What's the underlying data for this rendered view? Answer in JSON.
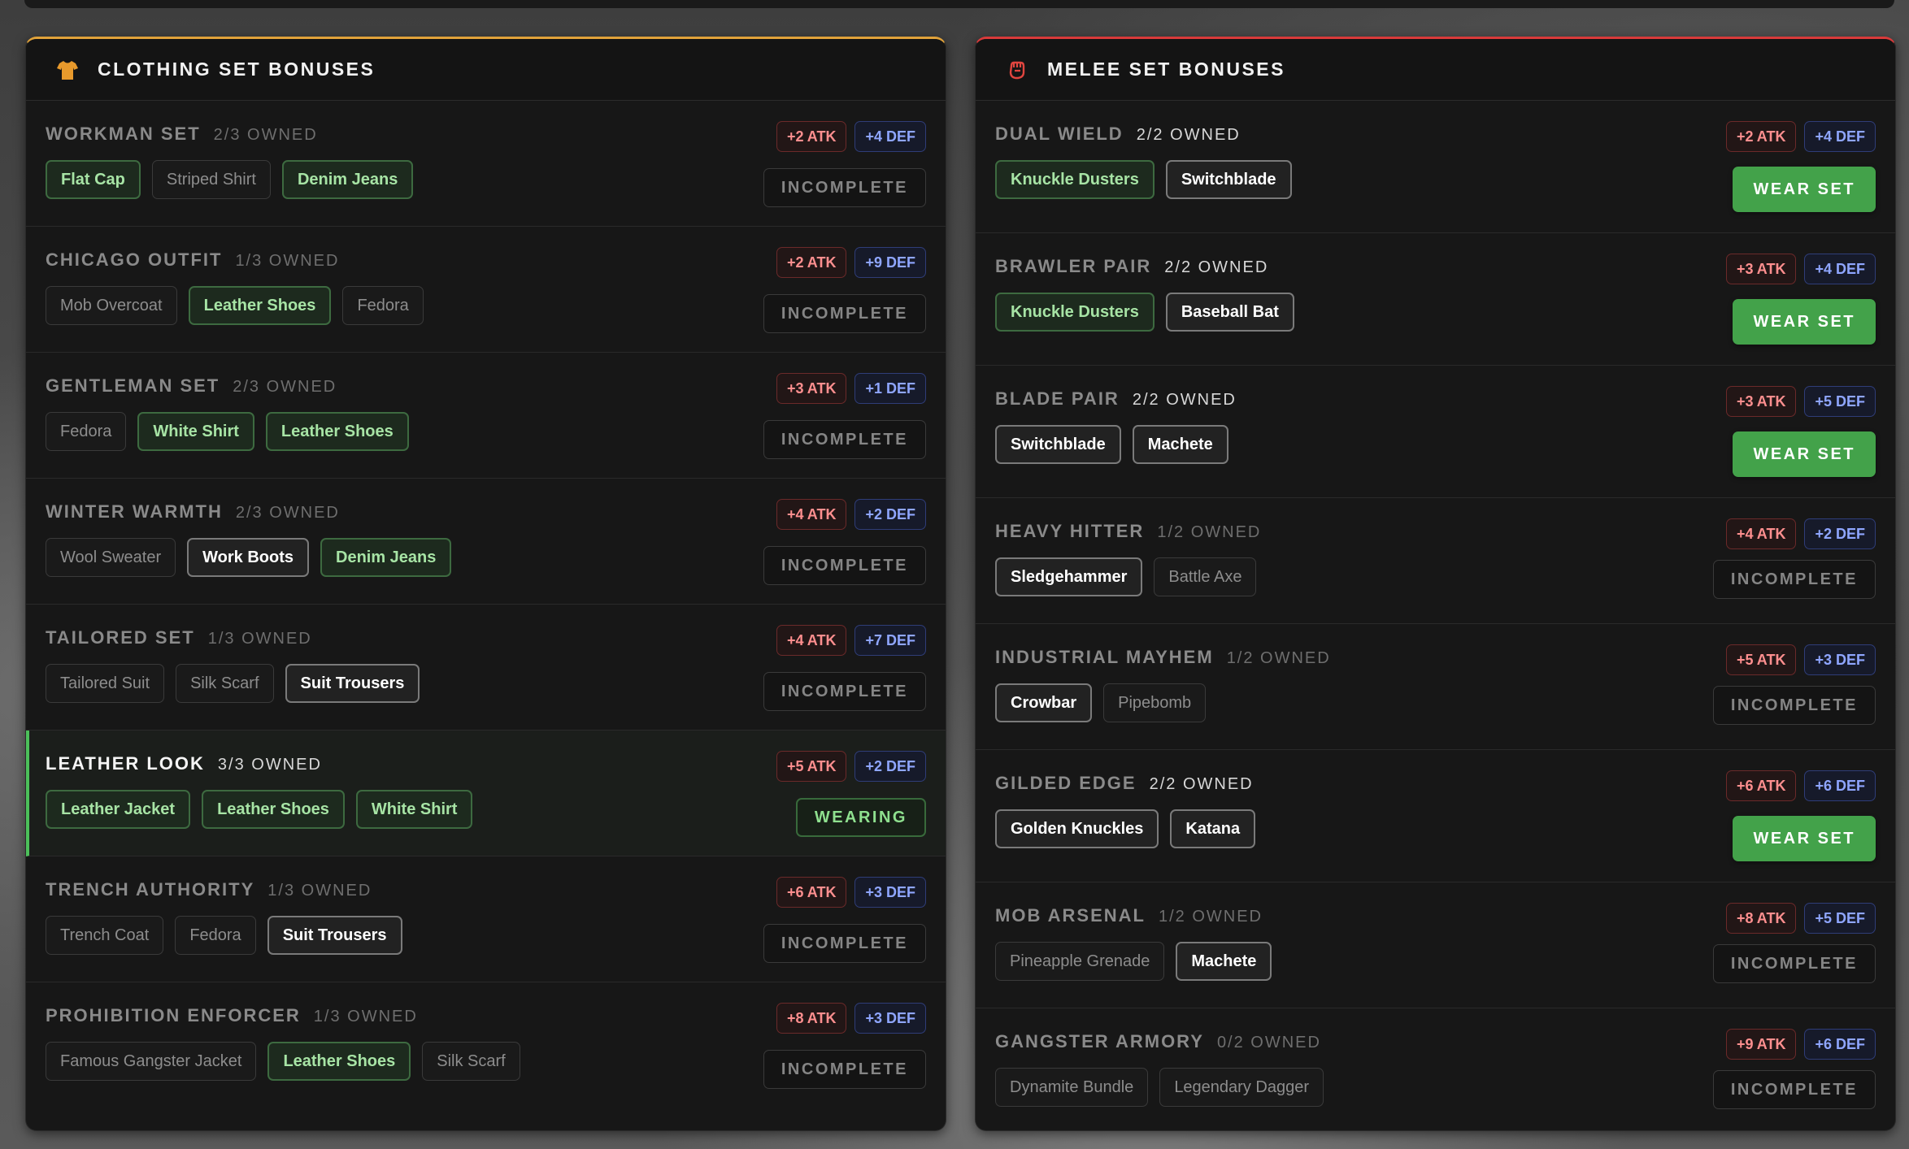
{
  "clothing": {
    "title": "CLOTHING SET BONUSES",
    "icon": "shirt-icon",
    "accent": "#e0a23a",
    "sets": [
      {
        "name": "WORKMAN SET",
        "owned": "2/3 OWNED",
        "atk": "+2 ATK",
        "def": "+4 DEF",
        "status": "INCOMPLETE",
        "items": [
          {
            "label": "Flat Cap",
            "state": "equipped"
          },
          {
            "label": "Striped Shirt",
            "state": "missing"
          },
          {
            "label": "Denim Jeans",
            "state": "equipped"
          }
        ]
      },
      {
        "name": "CHICAGO OUTFIT",
        "owned": "1/3 OWNED",
        "atk": "+2 ATK",
        "def": "+9 DEF",
        "status": "INCOMPLETE",
        "items": [
          {
            "label": "Mob Overcoat",
            "state": "missing"
          },
          {
            "label": "Leather Shoes",
            "state": "equipped"
          },
          {
            "label": "Fedora",
            "state": "missing"
          }
        ]
      },
      {
        "name": "GENTLEMAN SET",
        "owned": "2/3 OWNED",
        "atk": "+3 ATK",
        "def": "+1 DEF",
        "status": "INCOMPLETE",
        "items": [
          {
            "label": "Fedora",
            "state": "missing"
          },
          {
            "label": "White Shirt",
            "state": "equipped"
          },
          {
            "label": "Leather Shoes",
            "state": "equipped"
          }
        ]
      },
      {
        "name": "WINTER WARMTH",
        "owned": "2/3 OWNED",
        "atk": "+4 ATK",
        "def": "+2 DEF",
        "status": "INCOMPLETE",
        "items": [
          {
            "label": "Wool Sweater",
            "state": "missing"
          },
          {
            "label": "Work Boots",
            "state": "owned"
          },
          {
            "label": "Denim Jeans",
            "state": "equipped"
          }
        ]
      },
      {
        "name": "TAILORED SET",
        "owned": "1/3 OWNED",
        "atk": "+4 ATK",
        "def": "+7 DEF",
        "status": "INCOMPLETE",
        "items": [
          {
            "label": "Tailored Suit",
            "state": "missing"
          },
          {
            "label": "Silk Scarf",
            "state": "missing"
          },
          {
            "label": "Suit Trousers",
            "state": "owned"
          }
        ]
      },
      {
        "name": "LEATHER LOOK",
        "owned": "3/3 OWNED",
        "atk": "+5 ATK",
        "def": "+2 DEF",
        "status": "WEARING",
        "items": [
          {
            "label": "Leather Jacket",
            "state": "equipped"
          },
          {
            "label": "Leather Shoes",
            "state": "equipped"
          },
          {
            "label": "White Shirt",
            "state": "equipped"
          }
        ]
      },
      {
        "name": "TRENCH AUTHORITY",
        "owned": "1/3 OWNED",
        "atk": "+6 ATK",
        "def": "+3 DEF",
        "status": "INCOMPLETE",
        "items": [
          {
            "label": "Trench Coat",
            "state": "missing"
          },
          {
            "label": "Fedora",
            "state": "missing"
          },
          {
            "label": "Suit Trousers",
            "state": "owned"
          }
        ]
      },
      {
        "name": "PROHIBITION ENFORCER",
        "owned": "1/3 OWNED",
        "atk": "+8 ATK",
        "def": "+3 DEF",
        "status": "INCOMPLETE",
        "items": [
          {
            "label": "Famous Gangster Jacket",
            "state": "missing"
          },
          {
            "label": "Leather Shoes",
            "state": "equipped"
          },
          {
            "label": "Silk Scarf",
            "state": "missing"
          }
        ]
      }
    ]
  },
  "melee": {
    "title": "MELEE SET BONUSES",
    "icon": "fist-icon",
    "accent": "#d93a3a",
    "sets": [
      {
        "name": "DUAL WIELD",
        "owned": "2/2 OWNED",
        "atk": "+2 ATK",
        "def": "+4 DEF",
        "status": "WEAR SET",
        "items": [
          {
            "label": "Knuckle Dusters",
            "state": "equipped"
          },
          {
            "label": "Switchblade",
            "state": "owned"
          }
        ]
      },
      {
        "name": "BRAWLER PAIR",
        "owned": "2/2 OWNED",
        "atk": "+3 ATK",
        "def": "+4 DEF",
        "status": "WEAR SET",
        "items": [
          {
            "label": "Knuckle Dusters",
            "state": "equipped"
          },
          {
            "label": "Baseball Bat",
            "state": "owned"
          }
        ]
      },
      {
        "name": "BLADE PAIR",
        "owned": "2/2 OWNED",
        "atk": "+3 ATK",
        "def": "+5 DEF",
        "status": "WEAR SET",
        "items": [
          {
            "label": "Switchblade",
            "state": "owned"
          },
          {
            "label": "Machete",
            "state": "owned"
          }
        ]
      },
      {
        "name": "HEAVY HITTER",
        "owned": "1/2 OWNED",
        "atk": "+4 ATK",
        "def": "+2 DEF",
        "status": "INCOMPLETE",
        "items": [
          {
            "label": "Sledgehammer",
            "state": "owned"
          },
          {
            "label": "Battle Axe",
            "state": "missing"
          }
        ]
      },
      {
        "name": "INDUSTRIAL MAYHEM",
        "owned": "1/2 OWNED",
        "atk": "+5 ATK",
        "def": "+3 DEF",
        "status": "INCOMPLETE",
        "items": [
          {
            "label": "Crowbar",
            "state": "owned"
          },
          {
            "label": "Pipebomb",
            "state": "missing"
          }
        ]
      },
      {
        "name": "GILDED EDGE",
        "owned": "2/2 OWNED",
        "atk": "+6 ATK",
        "def": "+6 DEF",
        "status": "WEAR SET",
        "items": [
          {
            "label": "Golden Knuckles",
            "state": "owned"
          },
          {
            "label": "Katana",
            "state": "owned"
          }
        ]
      },
      {
        "name": "MOB ARSENAL",
        "owned": "1/2 OWNED",
        "atk": "+8 ATK",
        "def": "+5 DEF",
        "status": "INCOMPLETE",
        "items": [
          {
            "label": "Pineapple Grenade",
            "state": "missing"
          },
          {
            "label": "Machete",
            "state": "owned"
          }
        ]
      },
      {
        "name": "GANGSTER ARMORY",
        "owned": "0/2 OWNED",
        "atk": "+9 ATK",
        "def": "+6 DEF",
        "status": "INCOMPLETE",
        "items": [
          {
            "label": "Dynamite Bundle",
            "state": "missing"
          },
          {
            "label": "Legendary Dagger",
            "state": "missing"
          }
        ]
      }
    ]
  }
}
